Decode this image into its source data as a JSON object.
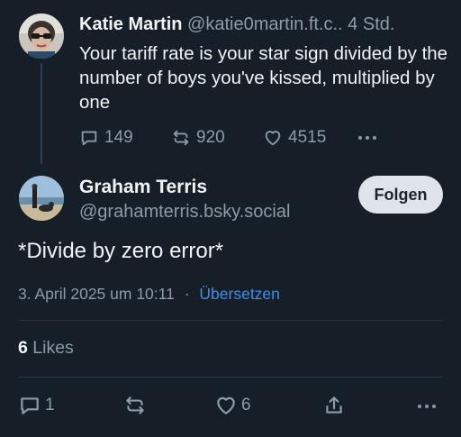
{
  "parent_post": {
    "author_name": "Katie Martin",
    "handle": "@katie0martin.ft.c..",
    "time": "4 Std.",
    "text": "Your tariff rate is your star sign divided by the number of boys you've kissed, multiplied by one",
    "replies": "149",
    "reposts": "920",
    "likes": "4515",
    "more_icon": "dots-icon"
  },
  "main_post": {
    "author_name": "Graham Terris",
    "handle": "@grahamterris.bsky.social",
    "follow_label": "Folgen",
    "text": "*Divide by zero error*",
    "date": "3. April 2025 um 10:11",
    "separator": "·",
    "translate_label": "Übersetzen",
    "likes_count": "6",
    "likes_label": "Likes",
    "reply_count": "1",
    "like_count": "6"
  },
  "colors": {
    "background": "#161e27",
    "muted": "#8d9ba8",
    "link": "#3b8ff0",
    "button_bg": "#dfe4ea"
  }
}
